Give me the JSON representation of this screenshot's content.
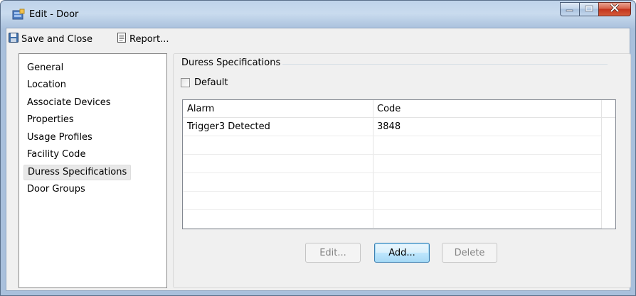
{
  "window": {
    "title": "Edit - Door",
    "icon": "door-app-icon"
  },
  "toolbar": {
    "save_label": "Save and Close",
    "report_label": "Report..."
  },
  "nav": {
    "items": [
      {
        "label": "General"
      },
      {
        "label": "Location"
      },
      {
        "label": "Associate Devices"
      },
      {
        "label": "Properties"
      },
      {
        "label": "Usage Profiles"
      },
      {
        "label": "Facility Code"
      },
      {
        "label": "Duress Specifications",
        "selected": true
      },
      {
        "label": "Door Groups"
      }
    ]
  },
  "content": {
    "group_title": "Duress Specifications",
    "default_checkbox": {
      "label": "Default",
      "checked": false
    },
    "grid": {
      "columns": [
        "Alarm",
        "Code"
      ],
      "rows": [
        {
          "alarm": "Trigger3 Detected",
          "code": "3848"
        }
      ]
    },
    "buttons": {
      "edit": {
        "label": "Edit...",
        "enabled": false
      },
      "add": {
        "label": "Add...",
        "enabled": true,
        "default": true
      },
      "delete": {
        "label": "Delete",
        "enabled": false
      }
    }
  },
  "colors": {
    "titlebar": "#bfd3ea",
    "close_button": "#c3341c",
    "default_button_border": "#3c7fb1"
  }
}
